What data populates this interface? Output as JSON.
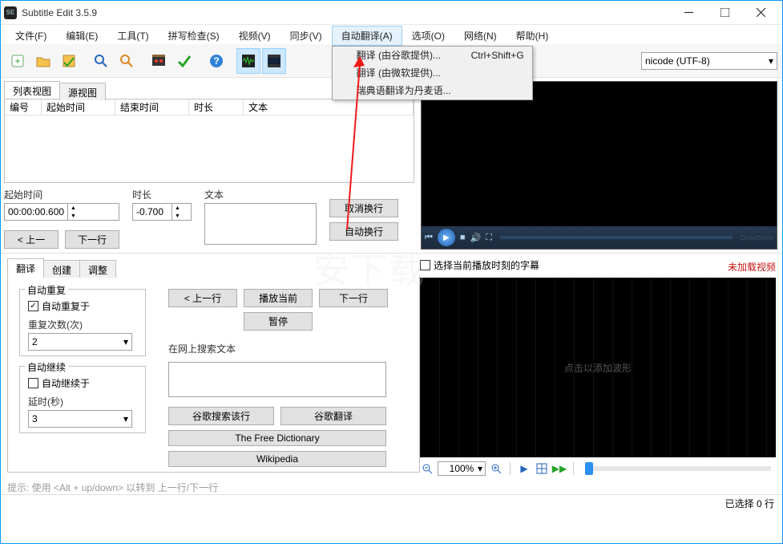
{
  "titlebar": {
    "app_icon_text": "SE",
    "title": "Subtitle Edit 3.5.9"
  },
  "menu": {
    "items": [
      "文件(F)",
      "编辑(E)",
      "工具(T)",
      "拼写检查(S)",
      "视频(V)",
      "同步(V)",
      "自动翻译(A)",
      "选项(O)",
      "网络(N)",
      "帮助(H)"
    ],
    "open_index": 6,
    "dropdown": [
      {
        "label": "翻译 (由谷歌提供)...",
        "shortcut": "Ctrl+Shift+G"
      },
      {
        "label": "翻译 (由微软提供)...",
        "shortcut": ""
      },
      {
        "label": "瑞典语翻译为丹麦语...",
        "shortcut": ""
      }
    ]
  },
  "toolbar": {
    "encoding": "nicode (UTF-8)"
  },
  "list_tabs": {
    "tab1": "列表视图",
    "tab2": "源视图",
    "active": 0
  },
  "table_headers": {
    "c0": "编号",
    "c1": "起始时间",
    "c2": "结束时间",
    "c3": "时长",
    "c4": "文本"
  },
  "edit": {
    "start_label": "起始时间",
    "start_value": "00:00:00.600",
    "dur_label": "时长",
    "dur_value": "-0.700",
    "text_label": "文本",
    "undo_wrap": "取消换行",
    "auto_wrap": "自动换行",
    "prev": "< 上一",
    "next": "下一行"
  },
  "video": {
    "directshow": "DirectShow"
  },
  "lower_tabs": {
    "t0": "翻译",
    "t1": "创建",
    "t2": "调整",
    "active": 0
  },
  "auto_repeat": {
    "title": "自动重复",
    "check": "自动重复于",
    "count_label": "重复次数(次)",
    "count_value": "2"
  },
  "auto_continue": {
    "title": "自动继续",
    "check": "自动继续于",
    "delay_label": "延时(秒)",
    "delay_value": "3"
  },
  "actions": {
    "prev": "< 上一行",
    "play_cur": "播放当前",
    "next": "下一行",
    "pause": "暂停",
    "search_label": "在网上搜索文本",
    "google_search": "谷歌搜索该行",
    "google_trans": "谷歌翻译",
    "free_dict": "The Free Dictionary",
    "wiki": "Wikipedia"
  },
  "hint": "提示: 使用 <Alt + up/down> 以转到 上一行/下一行",
  "wave": {
    "checkbox": "选择当前播放时刻的字幕",
    "not_loaded": "未加载视频",
    "click_add": "点击以添加波形",
    "zoom": "100%"
  },
  "status": "已选择 0 行"
}
